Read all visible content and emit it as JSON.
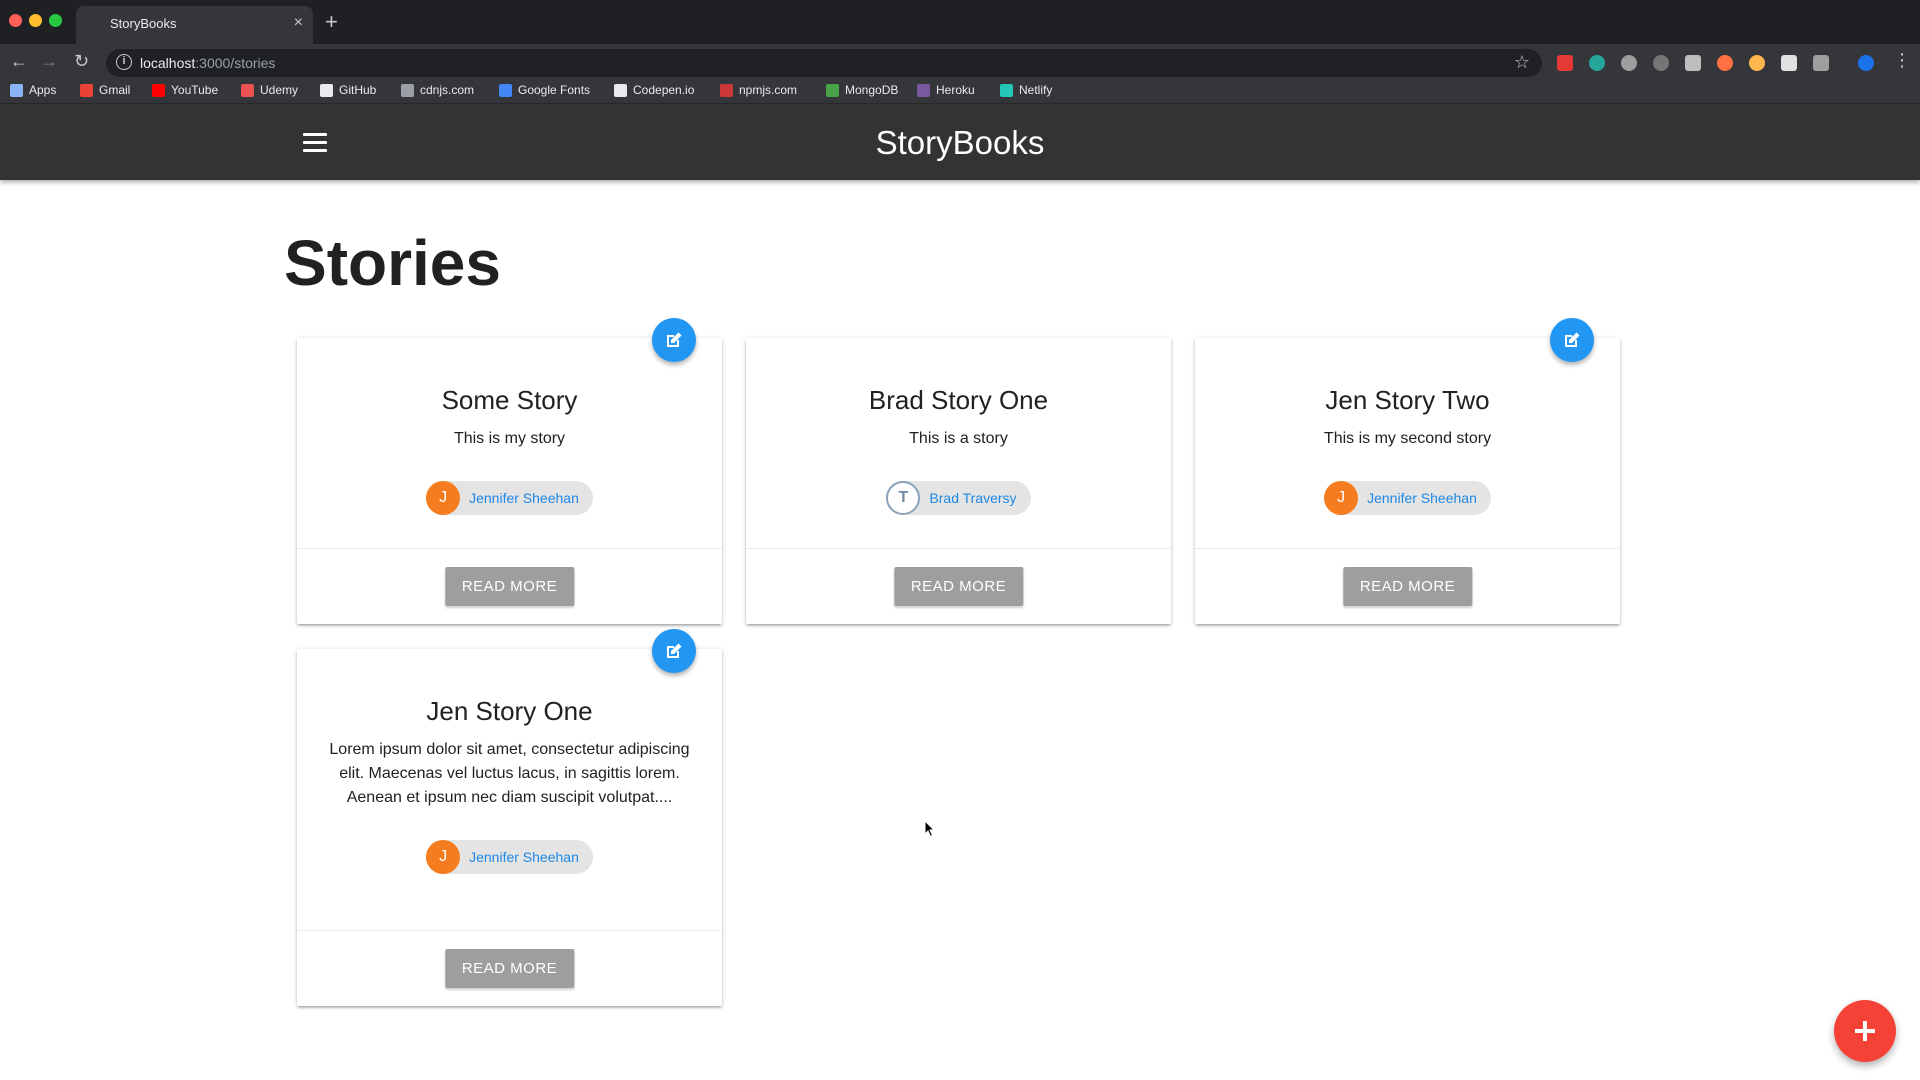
{
  "browser": {
    "tab_title": "StoryBooks",
    "tab_close": "×",
    "new_tab": "+",
    "url_host": "localhost",
    "url_path": ":3000/stories",
    "bookmarks": [
      {
        "label": "Apps",
        "icon": "apps-grid-icon",
        "color": "#8ab4f8"
      },
      {
        "label": "Gmail",
        "icon": "gmail-icon",
        "color": "#ea4335"
      },
      {
        "label": "YouTube",
        "icon": "youtube-icon",
        "color": "#ff0000"
      },
      {
        "label": "Udemy",
        "icon": "udemy-icon",
        "color": "#ec5252"
      },
      {
        "label": "GitHub",
        "icon": "github-icon",
        "color": "#e8eaed"
      },
      {
        "label": "cdnjs.com",
        "icon": "code-icon",
        "color": "#9aa0a6"
      },
      {
        "label": "Google Fonts",
        "icon": "google-fonts-icon",
        "color": "#4285f4"
      },
      {
        "label": "Codepen.io",
        "icon": "codepen-icon",
        "color": "#e8eaed"
      },
      {
        "label": "npmjs.com",
        "icon": "npm-icon",
        "color": "#cb3837"
      },
      {
        "label": "MongoDB",
        "icon": "mongodb-leaf-icon",
        "color": "#47a248"
      },
      {
        "label": "Heroku",
        "icon": "heroku-icon",
        "color": "#79589f"
      },
      {
        "label": "Netlify",
        "icon": "netlify-icon",
        "color": "#25c7b7"
      }
    ]
  },
  "app": {
    "brand": "StoryBooks",
    "nav_color": "#333333"
  },
  "page": {
    "title": "Stories"
  },
  "stories": [
    {
      "title": "Some Story",
      "body": "This is my story",
      "author": "Jennifer Sheehan",
      "avatar_letter": "J",
      "editable": true,
      "read_more": "READ MORE"
    },
    {
      "title": "Brad Story One",
      "body": "This is a story",
      "author": "Brad Traversy",
      "avatar_letter": "T",
      "editable": false,
      "read_more": "READ MORE"
    },
    {
      "title": "Jen Story Two",
      "body": "This is my second story",
      "author": "Jennifer Sheehan",
      "avatar_letter": "J",
      "editable": true,
      "read_more": "READ MORE"
    },
    {
      "title": "Jen Story One",
      "body": "Lorem ipsum dolor sit amet, consectetur adipiscing elit. Maecenas vel luctus lacus, in sagittis lorem. Aenean et ipsum nec diam suscipit volutpat....",
      "author": "Jennifer Sheehan",
      "avatar_letter": "J",
      "editable": true,
      "read_more": "READ MORE"
    }
  ],
  "colors": {
    "edit_button": "#2196f3",
    "fab": "#f44336",
    "read_more": "#9e9e9e",
    "author_link": "#1e88e5",
    "avatar_orange": "#f57c1f"
  }
}
